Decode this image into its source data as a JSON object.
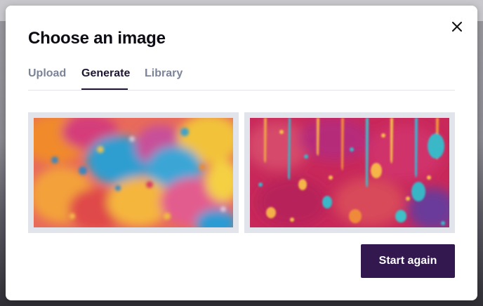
{
  "dialog": {
    "title": "Choose an image",
    "close_icon": "close-icon"
  },
  "tabs": [
    {
      "label": "Upload",
      "active": false
    },
    {
      "label": "Generate",
      "active": true
    },
    {
      "label": "Library",
      "active": false
    }
  ],
  "images": [
    {
      "name": "generated-image-paint-splatter",
      "icon": "image"
    },
    {
      "name": "generated-image-paint-drips",
      "icon": "image"
    }
  ],
  "actions": {
    "start_again_label": "Start again"
  },
  "colors": {
    "brand": "#33174f",
    "active_tab": "#1f1633",
    "inactive_tab": "#7a8397",
    "thumb_frame": "#e2e4ec"
  }
}
